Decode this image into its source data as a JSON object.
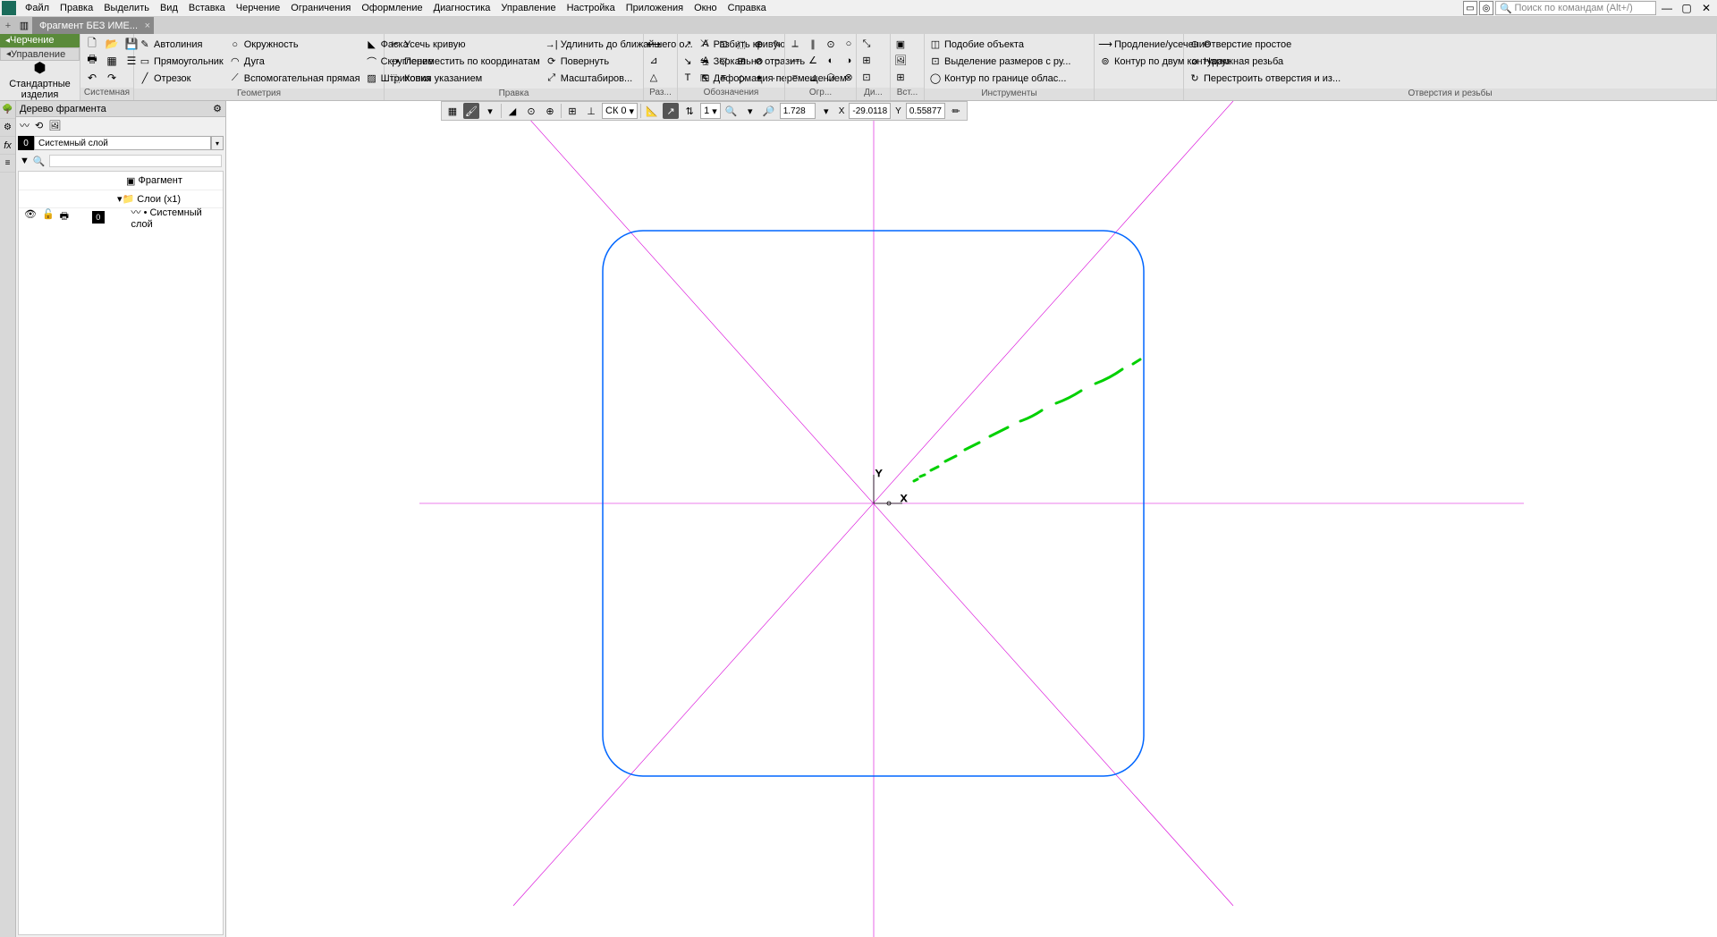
{
  "menu": {
    "items": [
      "Файл",
      "Правка",
      "Выделить",
      "Вид",
      "Вставка",
      "Черчение",
      "Ограничения",
      "Оформление",
      "Диагностика",
      "Управление",
      "Настройка",
      "Приложения",
      "Окно",
      "Справка"
    ],
    "search_placeholder": "Поиск по командам (Alt+/)"
  },
  "tab": {
    "title": "Фрагмент БЕЗ ИМЕ..."
  },
  "ribbon": {
    "left": {
      "tab1": "Черчение",
      "tab2": "Управление",
      "big": "Стандартные изделия"
    },
    "groups": [
      {
        "label": "Системная"
      },
      {
        "label": "Геометрия",
        "items": [
          "Автолиния",
          "Окружность",
          "Фаска",
          "Прямоугольник",
          "Дуга",
          "Скругление",
          "Отрезок",
          "Вспомогательная прямая",
          "Штриховка"
        ]
      },
      {
        "label": "Правка",
        "items": [
          "Усечь кривую",
          "Удлинить до ближайшего о...",
          "Разбить кривую",
          "Переместить по координатам",
          "Повернуть",
          "Зеркально отразить",
          "Копия указанием",
          "Масштабиров...",
          "Деформация перемещением"
        ]
      },
      {
        "label": "Раз..."
      },
      {
        "label": "Обозначения"
      },
      {
        "label": "Огр..."
      },
      {
        "label": "Ди..."
      },
      {
        "label": "Вст..."
      },
      {
        "label": "Инструменты",
        "items": [
          "Подобие объекта",
          "Продление/усечение",
          "Отверстие простое",
          "Выделение размеров с ру...",
          "Контур по двум контурам",
          "Наружная резьба",
          "Контур по границе облас...",
          "",
          "Перестроить отверстия и из..."
        ]
      },
      {
        "label": "Отверстия и резьбы"
      }
    ]
  },
  "panel": {
    "title": "Дерево фрагмента",
    "layer_num": "0",
    "layer_name": "Системный слой",
    "tree": {
      "root": "Фрагмент",
      "layers": "Слои (x1)",
      "layer": "Системный слой"
    }
  },
  "floatbar": {
    "cs": "СК 0",
    "step": "1",
    "zoom": "1.728",
    "x": "-29.0118",
    "y": "0.55877"
  },
  "canvas": {
    "axis_x": "X",
    "axis_y": "Y"
  }
}
